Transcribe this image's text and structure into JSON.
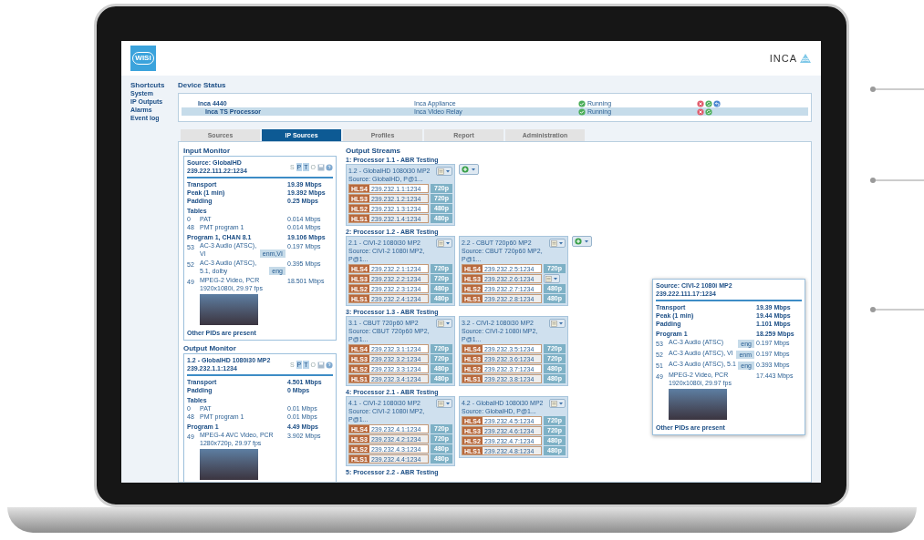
{
  "header": {
    "logo": "WISI",
    "brand": "INCA"
  },
  "shortcuts": {
    "title": "Shortcuts",
    "items": [
      "System",
      "IP Outputs",
      "Alarms",
      "Event log"
    ]
  },
  "device_status": {
    "title": "Device Status",
    "rows": [
      {
        "name": "Inca 4440",
        "type": "Inca Appliance",
        "status": "Running",
        "selected": false,
        "actions": [
          {
            "kind": "stop"
          },
          {
            "kind": "restart"
          },
          {
            "kind": "undo"
          }
        ],
        "children": [
          {
            "name": "Inca TS Processor",
            "type": "Inca Video Relay",
            "status": "Running",
            "selected": true,
            "actions": [
              {
                "kind": "stop"
              },
              {
                "kind": "restart"
              }
            ]
          }
        ]
      }
    ]
  },
  "tabs": [
    {
      "label": "Sources",
      "selected": false
    },
    {
      "label": "IP Sources",
      "selected": true
    },
    {
      "label": "Profiles",
      "selected": false
    },
    {
      "label": "Report",
      "selected": false
    },
    {
      "label": "Administration",
      "selected": false
    }
  ],
  "input_monitor": {
    "title": "Input Monitor",
    "card": {
      "heading": "Source: GlobalHD",
      "address": "239.222.111.22:1234",
      "flags": [
        {
          "label": "S",
          "on": false
        },
        {
          "label": "P",
          "on": true
        },
        {
          "label": "T",
          "on": true
        },
        {
          "label": "O",
          "on": false
        }
      ],
      "stats": [
        {
          "label": "Transport",
          "value": "19.39 Mbps"
        },
        {
          "label": "Peak (1 min)",
          "value": "19.392 Mbps"
        },
        {
          "label": "Padding",
          "value": "0.25 Mbps"
        }
      ],
      "tables_title": "Tables",
      "tables": [
        {
          "pid": "0",
          "name": "PAT",
          "rate": "0.014 Mbps"
        },
        {
          "pid": "48",
          "name": "PMT program 1",
          "rate": "0.014 Mbps"
        }
      ],
      "program": {
        "label": "Program 1, CHAN 8.1",
        "rate": "19.106 Mbps",
        "streams": [
          {
            "kind": "audio",
            "pid": "53",
            "name": "AC-3 Audio (ATSC), VI",
            "lang": "enm,VI",
            "rate": "0.197 Mbps"
          },
          {
            "kind": "audio",
            "pid": "52",
            "name": "AC-3 Audio (ATSC), 5.1, dolby",
            "lang": "eng",
            "rate": "0.395 Mbps"
          },
          {
            "kind": "video",
            "pid": "49",
            "name": "MPEG-2 Video, PCR 1920x1080i, 29.97 fps",
            "rate": "18.501 Mbps"
          }
        ]
      },
      "footer": "Other PIDs are present"
    }
  },
  "output_monitor": {
    "title": "Output Monitor",
    "card": {
      "heading": "1.2 - GlobalHD 1080i30 MP2",
      "address": "239.232.1.1:1234",
      "flags": [
        {
          "label": "S",
          "on": false
        },
        {
          "label": "P",
          "on": true
        },
        {
          "label": "T",
          "on": true
        },
        {
          "label": "O",
          "on": false
        }
      ],
      "stats": [
        {
          "label": "Transport",
          "value": "4.501 Mbps"
        },
        {
          "label": "Padding",
          "value": "0 Mbps"
        }
      ],
      "tables_title": "Tables",
      "tables": [
        {
          "pid": "0",
          "name": "PAT",
          "rate": "0.01 Mbps"
        },
        {
          "pid": "48",
          "name": "PMT program 1",
          "rate": "0.01 Mbps"
        }
      ],
      "program": {
        "label": "Program 1",
        "rate": "4.49 Mbps",
        "streams": [
          {
            "kind": "video",
            "pid": "49",
            "name": "MPEG-4 AVC Video, PCR 1280x720p, 29.97 fps",
            "rate": "3.902 Mbps"
          }
        ]
      }
    }
  },
  "output_streams": {
    "title": "Output Streams",
    "processors": [
      {
        "heading": "1: Processor 1.1 - ABR Testing",
        "add_button": true,
        "outputs": [
          {
            "title": "1.2 - GlobalHD 1080i30 MP2",
            "source": "Source: GlobalHD, P@1...",
            "variants": [
              {
                "kind": "resolution",
                "tag": "HLS4",
                "address": "239.232.1.1:1234",
                "res": "720p"
              },
              {
                "kind": "resolution",
                "tag": "HLS3",
                "address": "239.232.1.2:1234",
                "res": "720p"
              },
              {
                "kind": "resolution",
                "tag": "HLS2",
                "address": "239.232.1.3:1234",
                "res": "480p"
              },
              {
                "kind": "resolution",
                "tag": "HLS1",
                "address": "239.232.1.4:1234",
                "res": "480p"
              }
            ]
          }
        ]
      },
      {
        "heading": "2: Processor 1.2 - ABR Testing",
        "add_button": true,
        "outputs": [
          {
            "title": "2.1 - CIVI-2 1080i30 MP2",
            "source": "Source: CIVI-2 1080i MP2, P@1...",
            "variants": [
              {
                "kind": "resolution",
                "tag": "HLS4",
                "address": "239.232.2.1:1234",
                "res": "720p"
              },
              {
                "kind": "resolution",
                "tag": "HLS3",
                "address": "239.232.2.2:1234",
                "res": "720p"
              },
              {
                "kind": "resolution",
                "tag": "HLS2",
                "address": "239.232.2.3:1234",
                "res": "480p"
              },
              {
                "kind": "resolution",
                "tag": "HLS1",
                "address": "239.232.2.4:1234",
                "res": "480p"
              }
            ]
          },
          {
            "title": "2.2 - CBUT 720p60 MP2",
            "source": "Source: CBUT 720p60 MP2, P@1...",
            "variants": [
              {
                "kind": "resolution",
                "tag": "HLS4",
                "address": "239.232.2.5:1234",
                "res": "720p"
              },
              {
                "kind": "menu",
                "tag": "HLS3",
                "address": "239.232.2.6:1234"
              },
              {
                "kind": "resolution",
                "tag": "HLS2",
                "address": "239.232.2.7:1234",
                "res": "480p"
              },
              {
                "kind": "resolution",
                "tag": "HLS1",
                "address": "239.232.2.8:1234",
                "res": "480p"
              }
            ]
          }
        ]
      },
      {
        "heading": "3: Processor 1.3 - ABR Testing",
        "add_button": false,
        "outputs": [
          {
            "title": "3.1 - CBUT 720p60 MP2",
            "source": "Source: CBUT 720p60 MP2, P@1...",
            "variants": [
              {
                "kind": "resolution",
                "tag": "HLS4",
                "address": "239.232.3.1:1234",
                "res": "720p"
              },
              {
                "kind": "resolution",
                "tag": "HLS3",
                "address": "239.232.3.2:1234",
                "res": "720p"
              },
              {
                "kind": "resolution",
                "tag": "HLS2",
                "address": "239.232.3.3:1234",
                "res": "480p"
              },
              {
                "kind": "resolution",
                "tag": "HLS1",
                "address": "239.232.3.4:1234",
                "res": "480p"
              }
            ]
          },
          {
            "title": "3.2 - CIVI-2 1080i30 MP2",
            "source": "Source: CIVI-2 1080i MP2, P@1...",
            "variants": [
              {
                "kind": "resolution",
                "tag": "HLS4",
                "address": "239.232.3.5:1234",
                "res": "720p"
              },
              {
                "kind": "resolution",
                "tag": "HLS3",
                "address": "239.232.3.6:1234",
                "res": "720p"
              },
              {
                "kind": "resolution",
                "tag": "HLS2",
                "address": "239.232.3.7:1234",
                "res": "480p"
              },
              {
                "kind": "resolution",
                "tag": "HLS1",
                "address": "239.232.3.8:1234",
                "res": "480p"
              }
            ]
          }
        ]
      },
      {
        "heading": "4: Processor 2.1 - ABR Testing",
        "add_button": false,
        "outputs": [
          {
            "title": "4.1 - CIVI-2 1080i30 MP2",
            "source": "Source: CIVI-2 1080i MP2, P@1...",
            "variants": [
              {
                "kind": "resolution",
                "tag": "HLS4",
                "address": "239.232.4.1:1234",
                "res": "720p"
              },
              {
                "kind": "resolution",
                "tag": "HLS3",
                "address": "239.232.4.2:1234",
                "res": "720p"
              },
              {
                "kind": "resolution",
                "tag": "HLS2",
                "address": "239.232.4.3:1234",
                "res": "480p"
              },
              {
                "kind": "resolution",
                "tag": "HLS1",
                "address": "239.232.4.4:1234",
                "res": "480p"
              }
            ]
          },
          {
            "title": "4.2 - GlobalHD 1080i30 MP2",
            "source": "Source: GlobalHD, P@1...",
            "variants": [
              {
                "kind": "resolution",
                "tag": "HLS4",
                "address": "239.232.4.5:1234",
                "res": "720p"
              },
              {
                "kind": "resolution",
                "tag": "HLS3",
                "address": "239.232.4.6:1234",
                "res": "720p"
              },
              {
                "kind": "resolution",
                "tag": "HLS2",
                "address": "239.232.4.7:1234",
                "res": "480p"
              },
              {
                "kind": "resolution",
                "tag": "HLS1",
                "address": "239.232.4.8:1234",
                "res": "480p"
              }
            ]
          }
        ]
      },
      {
        "heading": "5: Processor 2.2 - ABR Testing"
      }
    ]
  },
  "popup": {
    "heading": "Source: CIVI-2 1080i MP2",
    "address": "239.222.111.17:1234",
    "stats": [
      {
        "label": "Transport",
        "value": "19.39 Mbps"
      },
      {
        "label": "Peak (1 min)",
        "value": "19.44 Mbps"
      },
      {
        "label": "Padding",
        "value": "1.101 Mbps"
      }
    ],
    "program": {
      "label": "Program 1",
      "rate": "18.259 Mbps",
      "streams": [
        {
          "kind": "audio",
          "pid": "53",
          "name": "AC-3 Audio (ATSC)",
          "lang": "eng",
          "rate": "0.197 Mbps"
        },
        {
          "kind": "audio",
          "pid": "52",
          "name": "AC-3 Audio (ATSC), VI",
          "lang": "enm",
          "rate": "0.197 Mbps"
        },
        {
          "kind": "audio",
          "pid": "51",
          "name": "AC-3 Audio (ATSC), 5.1",
          "lang": "eng",
          "rate": "0.393 Mbps"
        },
        {
          "kind": "video",
          "pid": "49",
          "name": "MPEG-2 Video, PCR 1920x1080i, 29.97 fps",
          "rate": "17.443 Mbps"
        }
      ]
    },
    "footer": "Other PIDs are present"
  }
}
